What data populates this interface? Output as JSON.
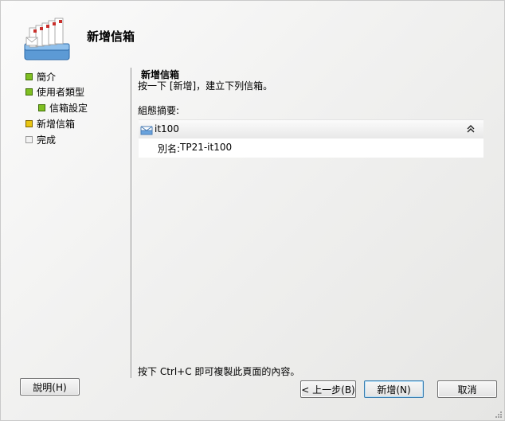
{
  "header": {
    "title": "新增信箱",
    "icon": "mailbox-wizard-icon"
  },
  "nav": {
    "items": [
      {
        "label": "簡介",
        "status": "completed",
        "color": "#7fbf22"
      },
      {
        "label": "使用者類型",
        "status": "completed",
        "color": "#7fbf22"
      },
      {
        "label": "信箱設定",
        "status": "completed",
        "color": "#7fbf22"
      },
      {
        "label": "新增信箱",
        "status": "current",
        "color": "#e9c511"
      },
      {
        "label": "完成",
        "status": "pending",
        "color": "#f2f2f2"
      }
    ]
  },
  "content": {
    "heading": "新增信箱",
    "description": "按一下 [新增]，建立下列信箱。",
    "summary_label": "組態摘要:",
    "summary": {
      "name": "it100",
      "alias_label": "別名:",
      "alias_value": "TP21-it100"
    },
    "copy_hint": "按下 Ctrl+C 即可複製此頁面的內容。"
  },
  "buttons": {
    "help": "說明(H)",
    "back": "< 上一步(B)",
    "new": "新增(N)",
    "cancel": "取消"
  }
}
